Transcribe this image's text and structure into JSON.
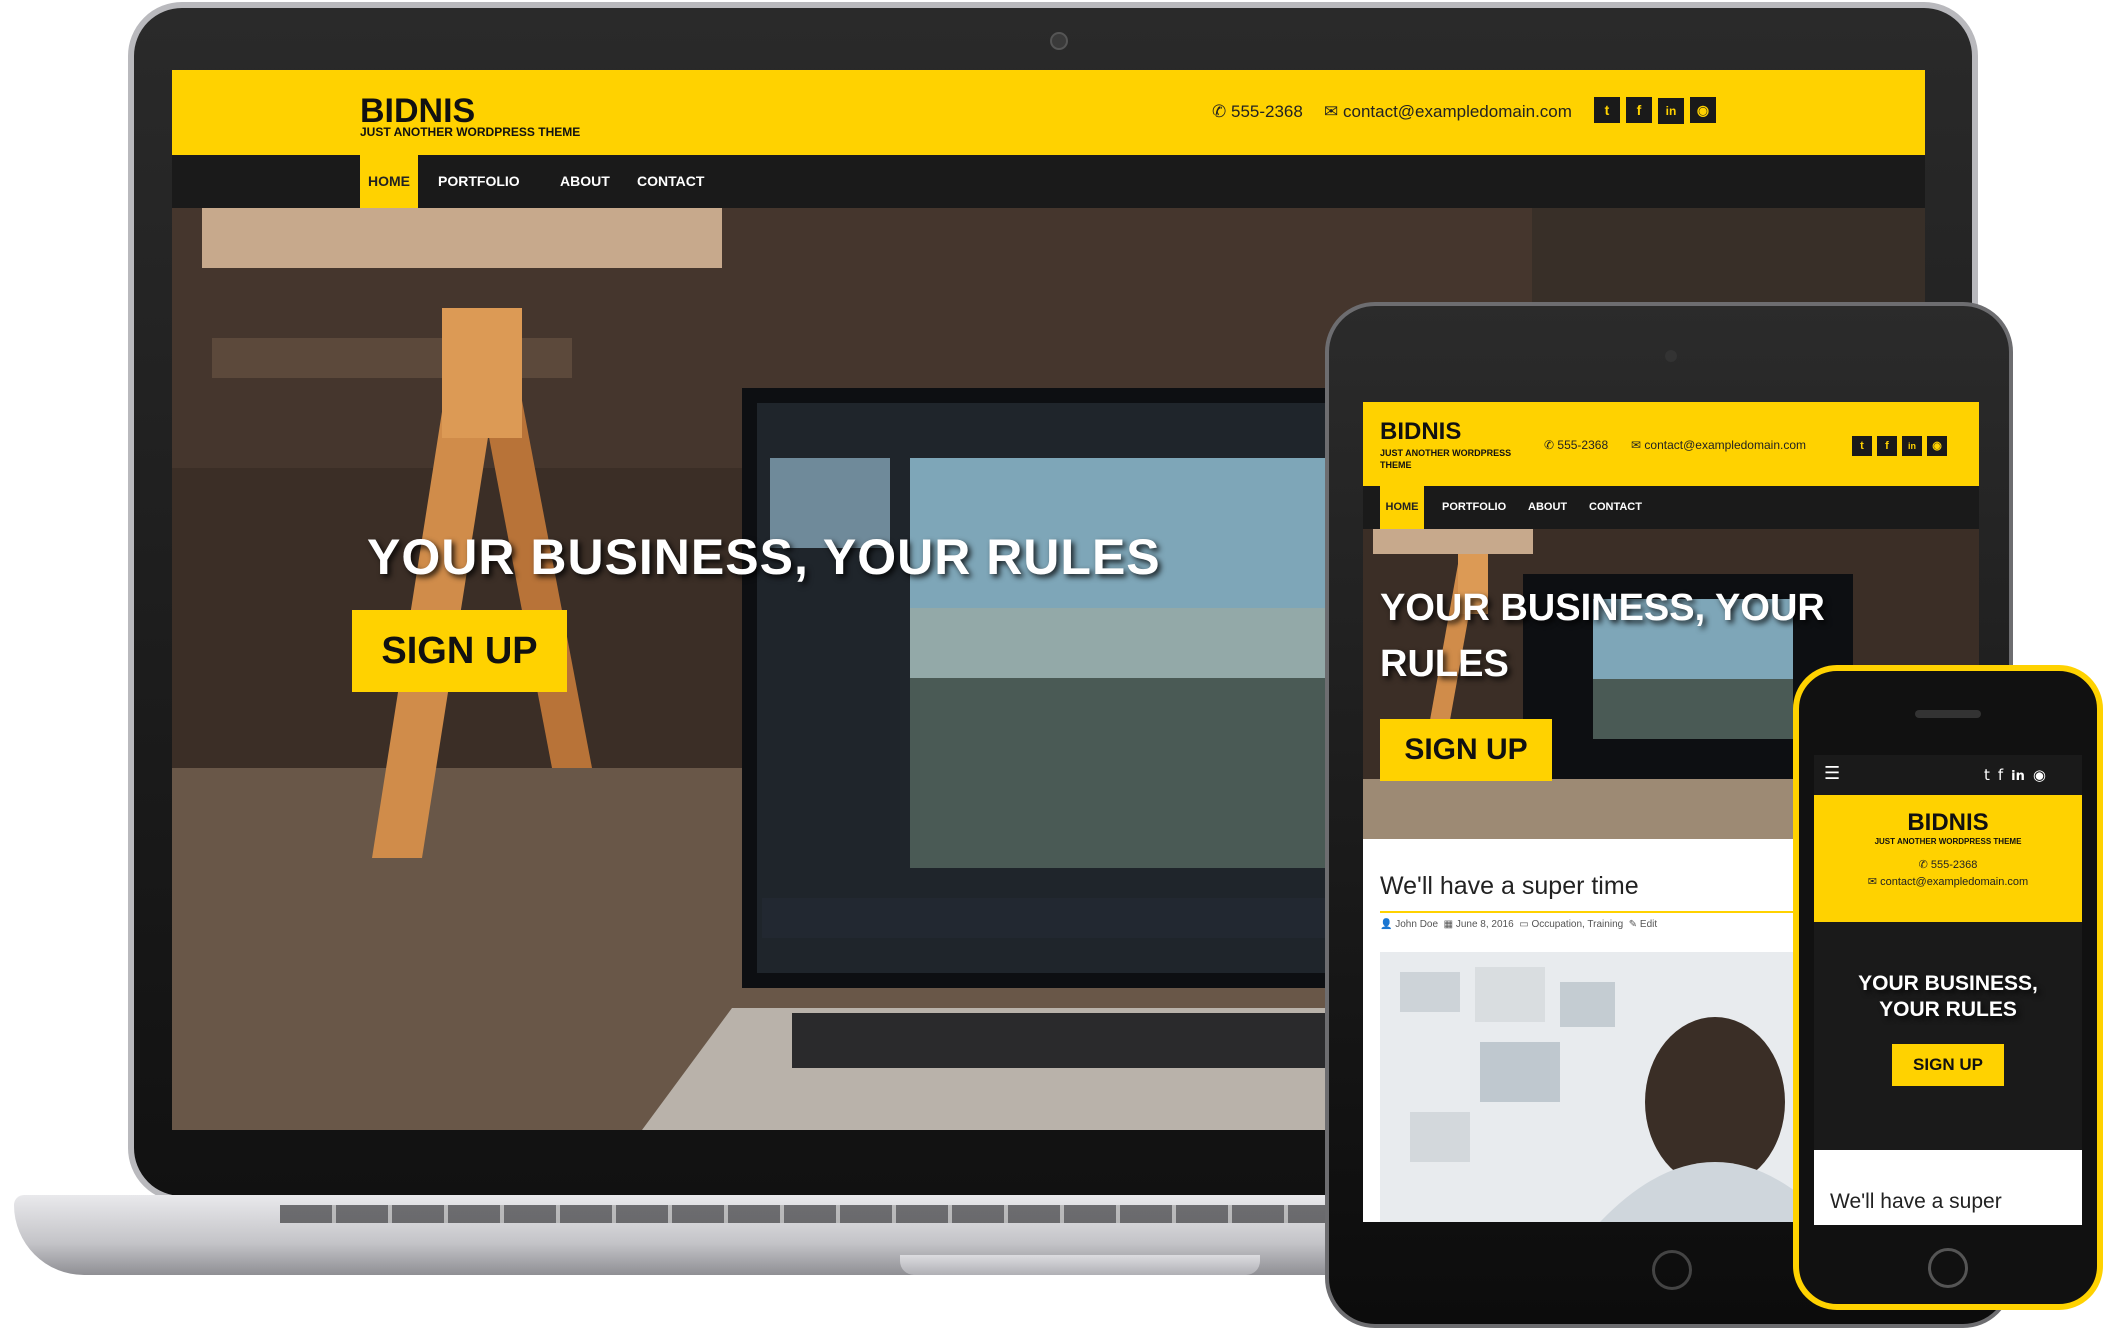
{
  "site": {
    "title": "BIDNIS",
    "tagline": "JUST ANOTHER WORDPRESS THEME",
    "tablet_tagline_line1": "JUST ANOTHER WORDPRESS",
    "tablet_tagline_line2": "THEME",
    "phone": "555-2368",
    "email": "contact@exampledomain.com",
    "social": [
      "twitter",
      "facebook",
      "linkedin",
      "github"
    ],
    "social_glyphs": {
      "twitter": "t",
      "facebook": "f",
      "linkedin": "in",
      "github": "◉"
    }
  },
  "nav": {
    "items": [
      "HOME",
      "PORTFOLIO",
      "ABOUT",
      "CONTACT"
    ],
    "active": "HOME"
  },
  "hero": {
    "heading": "YOUR BUSINESS, YOUR RULES",
    "tablet_heading_line1": "YOUR BUSINESS, YOUR",
    "tablet_heading_line2": "RULES",
    "phone_heading_line1": "YOUR BUSINESS,",
    "phone_heading_line2": "YOUR RULES",
    "button": "SIGN UP"
  },
  "post": {
    "title": "We'll have a super time",
    "phone_title_partial": "We'll have a super",
    "author": "John Doe",
    "date": "June 8, 2016",
    "categories": "Occupation, Training",
    "edit": "Edit"
  },
  "colors": {
    "accent": "#ffd200",
    "dark": "#1a1a1a",
    "phone_frame": "#ffd200"
  },
  "icons": {
    "phone_icon": "phone-icon",
    "email_icon": "envelope-icon",
    "menu_icon": "hamburger-icon",
    "author_icon": "user-icon",
    "date_icon": "calendar-icon",
    "category_icon": "folder-icon",
    "edit_icon": "pencil-icon"
  }
}
